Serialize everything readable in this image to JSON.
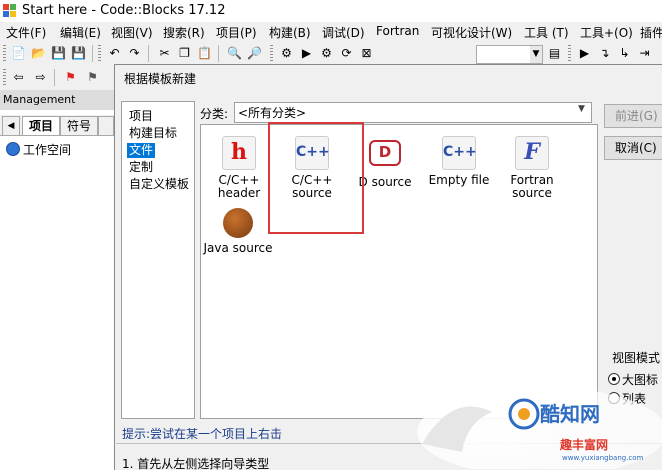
{
  "window": {
    "title": "Start here - Code::Blocks 17.12"
  },
  "menu": [
    "文件(F)",
    "编辑(E)",
    "视图(V)",
    "搜索(R)",
    "项目(P)",
    "构建(B)",
    "调试(D)",
    "Fortran",
    "可视化设计(W)",
    "工具 (T)",
    "工具+(O)",
    "插件"
  ],
  "toolbar": {
    "icons": [
      "new-file-icon",
      "open-icon",
      "save-icon",
      "save-all-icon",
      "undo-icon",
      "redo-icon",
      "cut-icon",
      "copy-icon",
      "paste-icon",
      "find-icon",
      "replace-icon",
      "build-settings-icon",
      "run-icon",
      "build-run-icon",
      "build-icon",
      "abort-icon"
    ],
    "icons2": [
      "back-icon",
      "forward-icon",
      "bookmark-icon",
      "bookmark-next-icon"
    ]
  },
  "management": {
    "title": "Management",
    "tabs": [
      "项目",
      "符号"
    ],
    "workspace": "工作空间"
  },
  "dialog": {
    "title": "根据模板新建",
    "categories": [
      "项目",
      "构建目标",
      "文件",
      "定制",
      "自定义模板"
    ],
    "selected_category": "文件",
    "category_label": "分类:",
    "category_value": "<所有分类>",
    "items": [
      {
        "line1": "C/C++",
        "line2": "header",
        "icon": "h",
        "color": "#d11"
      },
      {
        "line1": "C/C++",
        "line2": "source",
        "icon": "C++",
        "color": "#2a4fa8"
      },
      {
        "line1": "D source",
        "line2": "",
        "icon": "D",
        "color": "#c0262d"
      },
      {
        "line1": "Empty file",
        "line2": "",
        "icon": "C++",
        "color": "#2a4fa8"
      },
      {
        "line1": "Fortran",
        "line2": "source",
        "icon": "F",
        "color": "#3a4fb8"
      },
      {
        "line1": "Java source",
        "line2": "",
        "icon": "bean",
        "color": "#8a4a1a"
      }
    ],
    "next_button": "前进(G)",
    "cancel_button": "取消(C)",
    "view_mode_label": "视图模式",
    "view_large": "大图标",
    "view_list": "列表",
    "hint": "提示:尝试在某一个项目上右击",
    "description": "1. 首先从左侧选择向导类型"
  },
  "watermark": {
    "name": "酷知网",
    "sub": "趣丰富网",
    "url": "www.yuxiangbang.com"
  }
}
